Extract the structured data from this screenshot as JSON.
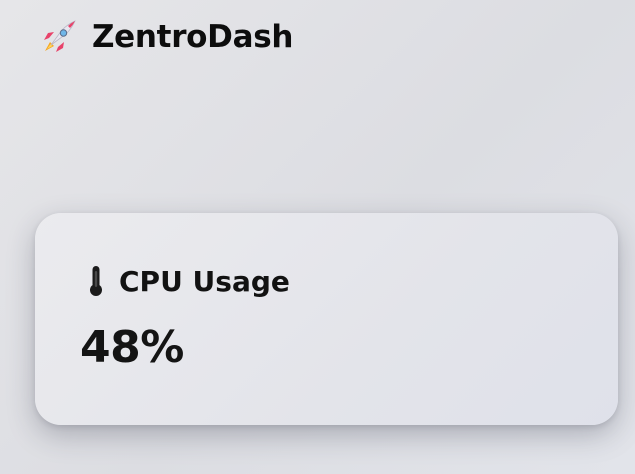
{
  "app": {
    "title": "ZentroDash",
    "logo_icon": "rocket-icon"
  },
  "card": {
    "label": "CPU Usage",
    "value": "48%",
    "icon": "thermometer-icon"
  },
  "colors": {
    "background": "#e1e2e6",
    "card_background": "#e6e7ec",
    "text": "#111111",
    "rocket_body": "#e9e7f0",
    "rocket_accent": "#e8426a",
    "rocket_window": "#6fb6e8",
    "rocket_flame": "#f5a623"
  }
}
